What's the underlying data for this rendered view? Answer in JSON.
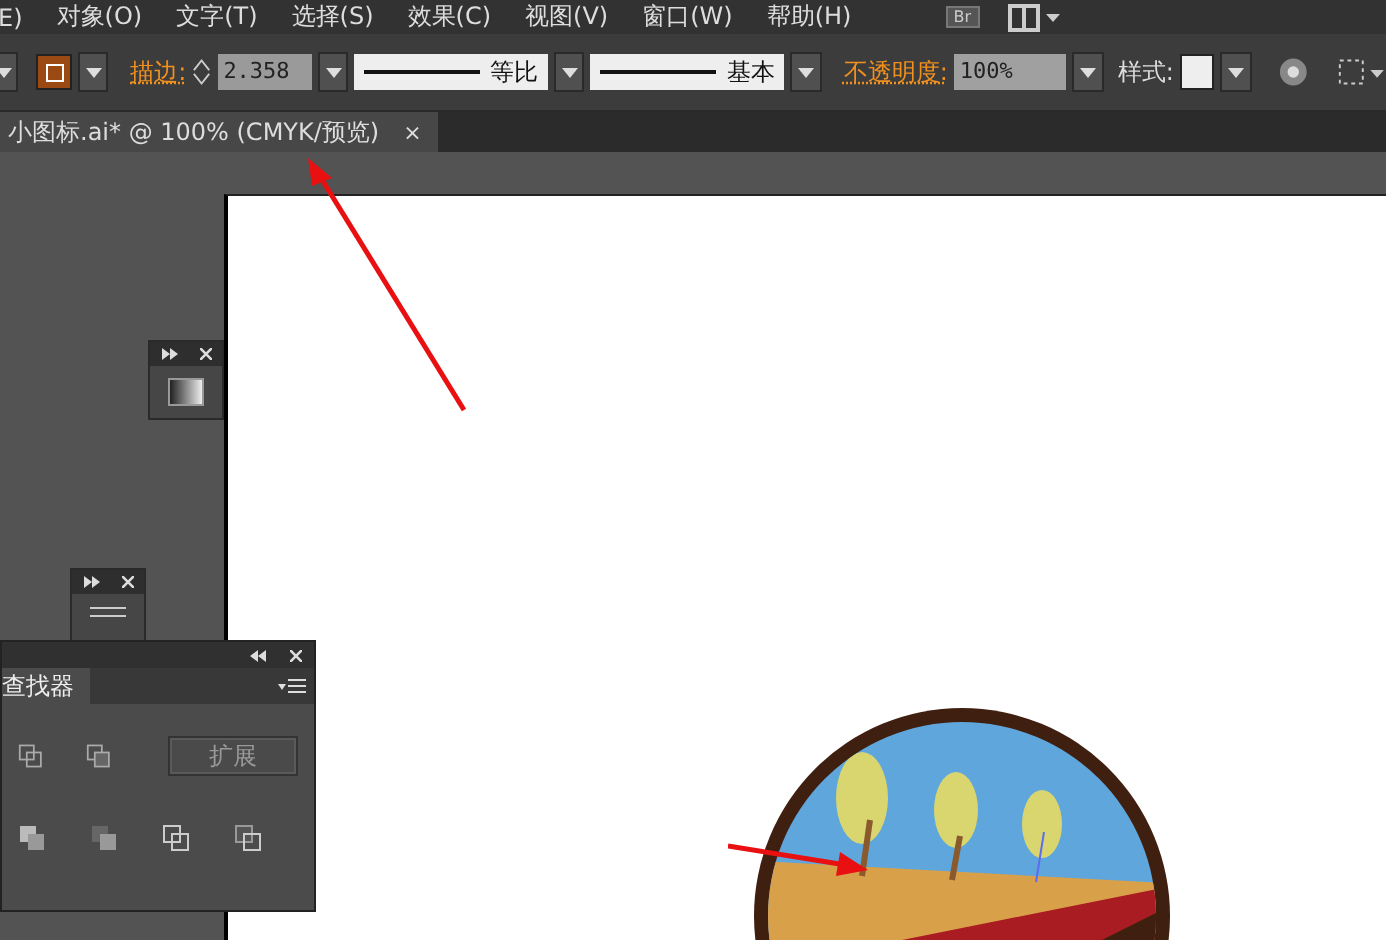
{
  "menu_bar": {
    "items": [
      "E)",
      "对象(O)",
      "文字(T)",
      "选择(S)",
      "效果(C)",
      "视图(V)",
      "窗口(W)",
      "帮助(H)"
    ],
    "bridge_badge": "Br"
  },
  "control_bar": {
    "stroke_label": "描边:",
    "stroke_value": "2.358",
    "profile_1": "等比",
    "profile_2": "基本",
    "opacity_label": "不透明度:",
    "opacity_value": "100%",
    "style_label": "样式:"
  },
  "document_tab": {
    "title": "小图标.ai* @ 100% (CMYK/预览)",
    "close": "×"
  },
  "pathfinder_panel": {
    "tab": "查找器",
    "expand_button": "扩展"
  }
}
